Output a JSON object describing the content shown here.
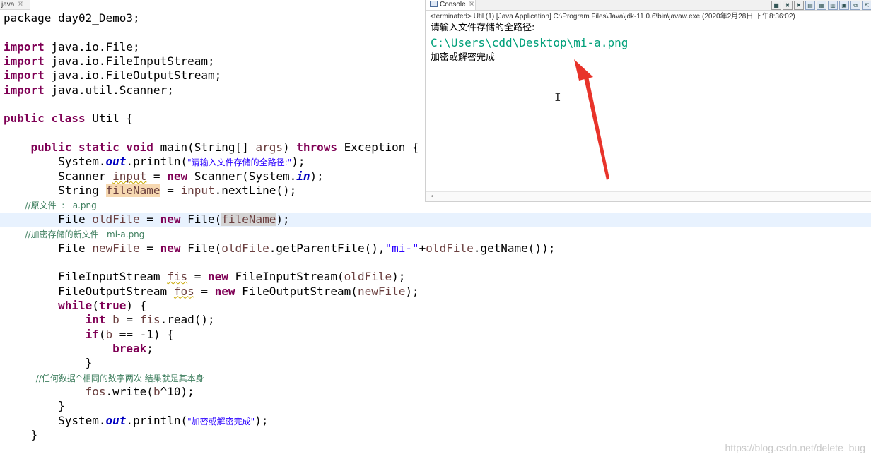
{
  "editor": {
    "tab_label": "java",
    "tab_close": "☒"
  },
  "code": {
    "l1": [
      "package day02_Demo3;"
    ],
    "l3": [
      "import",
      " java.io.File;"
    ],
    "l4": [
      "import",
      " java.io.FileInputStream;"
    ],
    "l5": [
      "import",
      " java.io.FileOutputStream;"
    ],
    "l6": [
      "import",
      " java.util.Scanner;"
    ],
    "l8": [
      "public",
      " ",
      "class",
      " Util {"
    ],
    "l10": [
      "    ",
      "public",
      " ",
      "static",
      " ",
      "void",
      " main(String[] ",
      "args",
      ") ",
      "throws",
      " Exception {"
    ],
    "l11": [
      "        System.",
      "out",
      ".println(",
      "\"请输入文件存储的全路径:\"",
      ");"
    ],
    "l12": [
      "        Scanner ",
      "input",
      " = ",
      "new",
      " Scanner(System.",
      "in",
      ");"
    ],
    "l13": [
      "        String ",
      "fileName",
      " = ",
      "input",
      ".nextLine();"
    ],
    "l14": [
      "        //原文件  :   a.png"
    ],
    "l15": [
      "        File ",
      "oldFile",
      " = ",
      "new",
      " File(",
      "fileName",
      ");"
    ],
    "l16": [
      "        //加密存储的新文件   mi-a.png"
    ],
    "l17": [
      "        File ",
      "newFile",
      " = ",
      "new",
      " File(",
      "oldFile",
      ".getParentFile(),",
      "\"mi-\"",
      "+",
      "oldFile",
      ".getName());"
    ],
    "l19": [
      "        FileInputStream ",
      "fis",
      " = ",
      "new",
      " FileInputStream(",
      "oldFile",
      ");"
    ],
    "l20": [
      "        FileOutputStream ",
      "fos",
      " = ",
      "new",
      " FileOutputStream(",
      "newFile",
      ");"
    ],
    "l21": [
      "        ",
      "while",
      "(",
      "true",
      ") {"
    ],
    "l22": [
      "            ",
      "int",
      " ",
      "b",
      " = ",
      "fis",
      ".read();"
    ],
    "l23": [
      "            ",
      "if",
      "(",
      "b",
      " == -1) {"
    ],
    "l24": [
      "                ",
      "break",
      ";"
    ],
    "l25": [
      "            }"
    ],
    "l26": [
      "            //任何数据^相同的数字两次 结果就是其本身"
    ],
    "l27": [
      "            ",
      "fos",
      ".write(",
      "b",
      "^10);"
    ],
    "l28": [
      "        }"
    ],
    "l29": [
      "        System.",
      "out",
      ".println(",
      "\"加密或解密完成\"",
      ");"
    ],
    "l30": [
      "    }"
    ]
  },
  "console": {
    "tab_label": "Console",
    "tab_close": "☒",
    "status": "<terminated> Util (1) [Java Application] C:\\Program Files\\Java\\jdk-11.0.6\\bin\\javaw.exe (2020年2月28日 下午8:36:02)",
    "prompt": "请输入文件存储的全路径:",
    "user_input": "C:\\Users\\cdd\\Desktop\\mi-a.png",
    "result": "加密或解密完成",
    "scroll_arrow": "◂",
    "cursor_glyph": "I",
    "toolbar": [
      "■",
      "✖",
      "✖",
      "▤",
      "▦",
      "▥",
      "▣",
      "⧉",
      "⇱"
    ]
  },
  "colors": {
    "keyword": "#7f0055",
    "string": "#2a00ff",
    "comment": "#3f7f5f",
    "console_input": "#00a07a",
    "arrow": "#e8332a"
  },
  "watermark": "https://blog.csdn.net/delete_bug"
}
